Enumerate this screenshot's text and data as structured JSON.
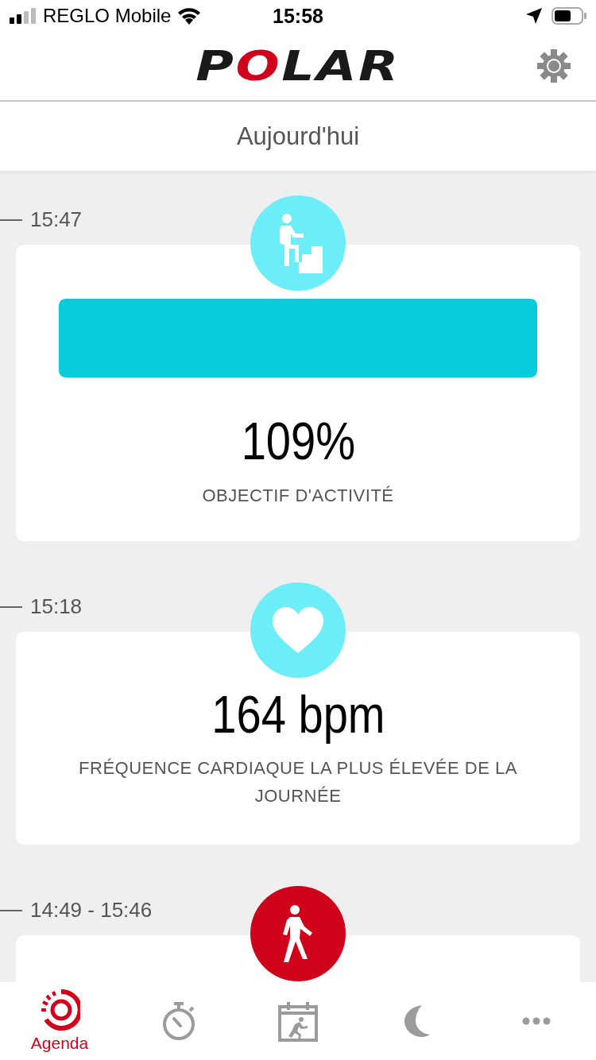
{
  "status_bar": {
    "carrier": "REGLO Mobile",
    "time": "15:58"
  },
  "header": {
    "logo": "POLAR"
  },
  "title": "Aujourd'hui",
  "feed": [
    {
      "time": "15:47",
      "color": "#6ceef8",
      "kind": "progress",
      "level": 1,
      "value": "109%",
      "label": "OBJECTIF D'ACTIVITÉ"
    },
    {
      "time": "15:18",
      "color": "#6ceef8",
      "kind": "value",
      "value": "164 bpm",
      "label": "FRÉQUENCE CARDIAQUE LA PLUS ÉLEVÉE DE LA JOURNÉE"
    },
    {
      "time": "14:49 - 15:46",
      "color": "#d0021b",
      "kind": "empty"
    }
  ],
  "tabs": [
    {
      "kind": "agenda",
      "label": "Agenda",
      "selected": true
    },
    {
      "kind": "stopwatch",
      "selected": false
    },
    {
      "kind": "calendar",
      "selected": false
    },
    {
      "kind": "moon",
      "selected": false
    },
    {
      "kind": "more",
      "selected": false
    }
  ]
}
